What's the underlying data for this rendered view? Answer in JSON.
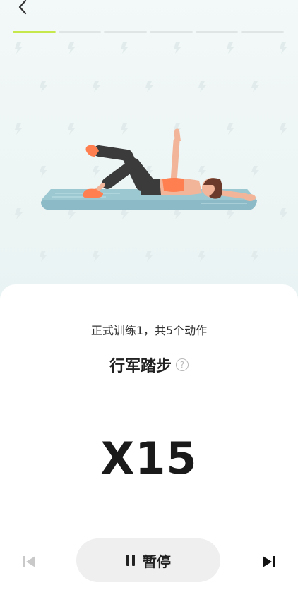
{
  "header": {
    "back_icon": "chevron-left-icon"
  },
  "progress": {
    "total_segments": 6,
    "current_segment": 1,
    "active_color": "#c6e84c"
  },
  "card": {
    "subtitle": "正式训练1，共5个动作",
    "exercise_title": "行军踏步",
    "help_icon_label": "?",
    "reps": "X15"
  },
  "controls": {
    "pause_label": "暂停",
    "prev_icon": "skip-previous-icon",
    "next_icon": "skip-next-icon",
    "pause_icon": "pause-icon"
  }
}
